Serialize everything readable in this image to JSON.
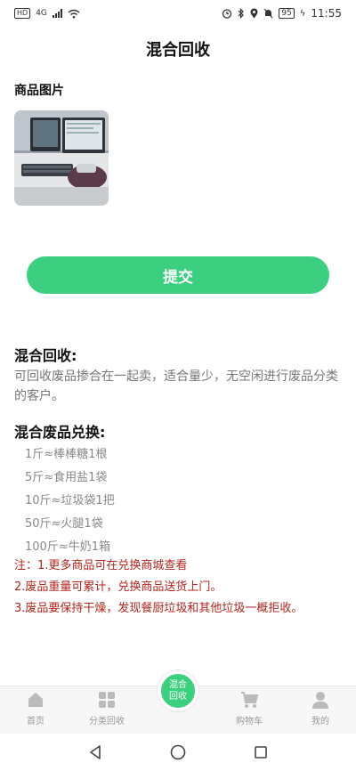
{
  "status_bar": {
    "hd": "HD",
    "network": "4G",
    "battery": "95",
    "time": "11:55"
  },
  "header": {
    "title": "混合回收"
  },
  "photo_section": {
    "label": "商品图片"
  },
  "submit": {
    "label": "提交"
  },
  "mixed_recycling": {
    "title": "混合回收:",
    "description": "可回收废品掺合在一起卖，适合量少，无空闲进行废品分类的客户。"
  },
  "exchange": {
    "title": "混合废品兑换:",
    "items": [
      "1斤≈棒棒糖1根",
      "5斤≈食用盐1袋",
      "10斤≈垃圾袋1把",
      "50斤≈火腿1袋",
      "100斤≈牛奶1箱"
    ]
  },
  "notes": [
    "注：1.更多商品可在兑换商城查看",
    "2.废品重量可累计，兑换商品送货上门。",
    "3.废品要保持干燥，发现餐厨垃圾和其他垃圾一概拒收。"
  ],
  "tabbar": {
    "items": [
      {
        "label": "首页",
        "icon": "home-icon"
      },
      {
        "label": "分类回收",
        "icon": "grid-icon"
      },
      {
        "label": "混合回收",
        "icon": "center-button",
        "line1": "混合",
        "line2": "回收"
      },
      {
        "label": "购物车",
        "icon": "cart-icon"
      },
      {
        "label": "我的",
        "icon": "user-icon"
      }
    ]
  },
  "colors": {
    "accent": "#3bcf7f",
    "warning_text": "#b3261e"
  }
}
